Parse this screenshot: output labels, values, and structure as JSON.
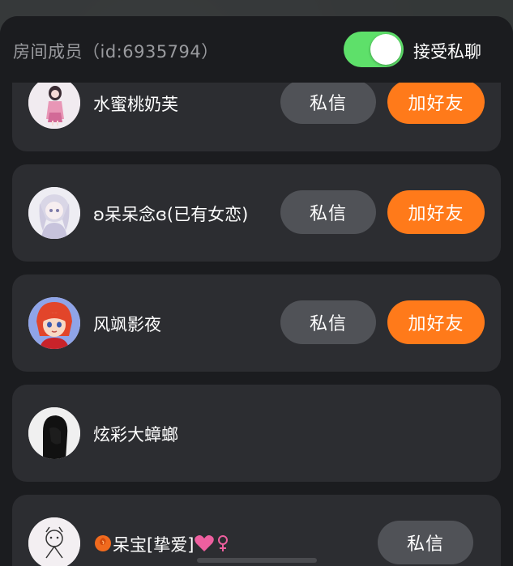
{
  "header": {
    "room_title": "房间成员（id:6935794）",
    "toggle_label": "接受私聊",
    "toggle_on": true,
    "toggle_on_color": "#5ee06a"
  },
  "members": [
    {
      "name": "水蜜桃奶芙",
      "msg_label": "私信",
      "add_label": "加好友",
      "avatar": "pink-anime-girl-avatar"
    },
    {
      "name": "ʚ呆呆念ɞ(已有女恋)",
      "msg_label": "私信",
      "add_label": "加好友",
      "avatar": "white-hair-anime-avatar"
    },
    {
      "name": "风飒影夜",
      "msg_label": "私信",
      "add_label": "加好友",
      "avatar": "red-hair-anime-avatar"
    },
    {
      "name": "炫彩大蟑螂",
      "avatar": "black-silhouette-avatar"
    },
    {
      "name_prefix_icon": "rose-icon",
      "name": "呆宝[挚爱]",
      "name_suffix_icons": [
        "heart-icon",
        "female-symbol-icon"
      ],
      "msg_label": "私信",
      "avatar": "sketch-character-avatar"
    }
  ],
  "colors": {
    "accent_orange": "#ff7a1a",
    "button_gray": "#505257",
    "card_bg": "#2c2d31",
    "panel_bg": "#1b1c1f"
  }
}
